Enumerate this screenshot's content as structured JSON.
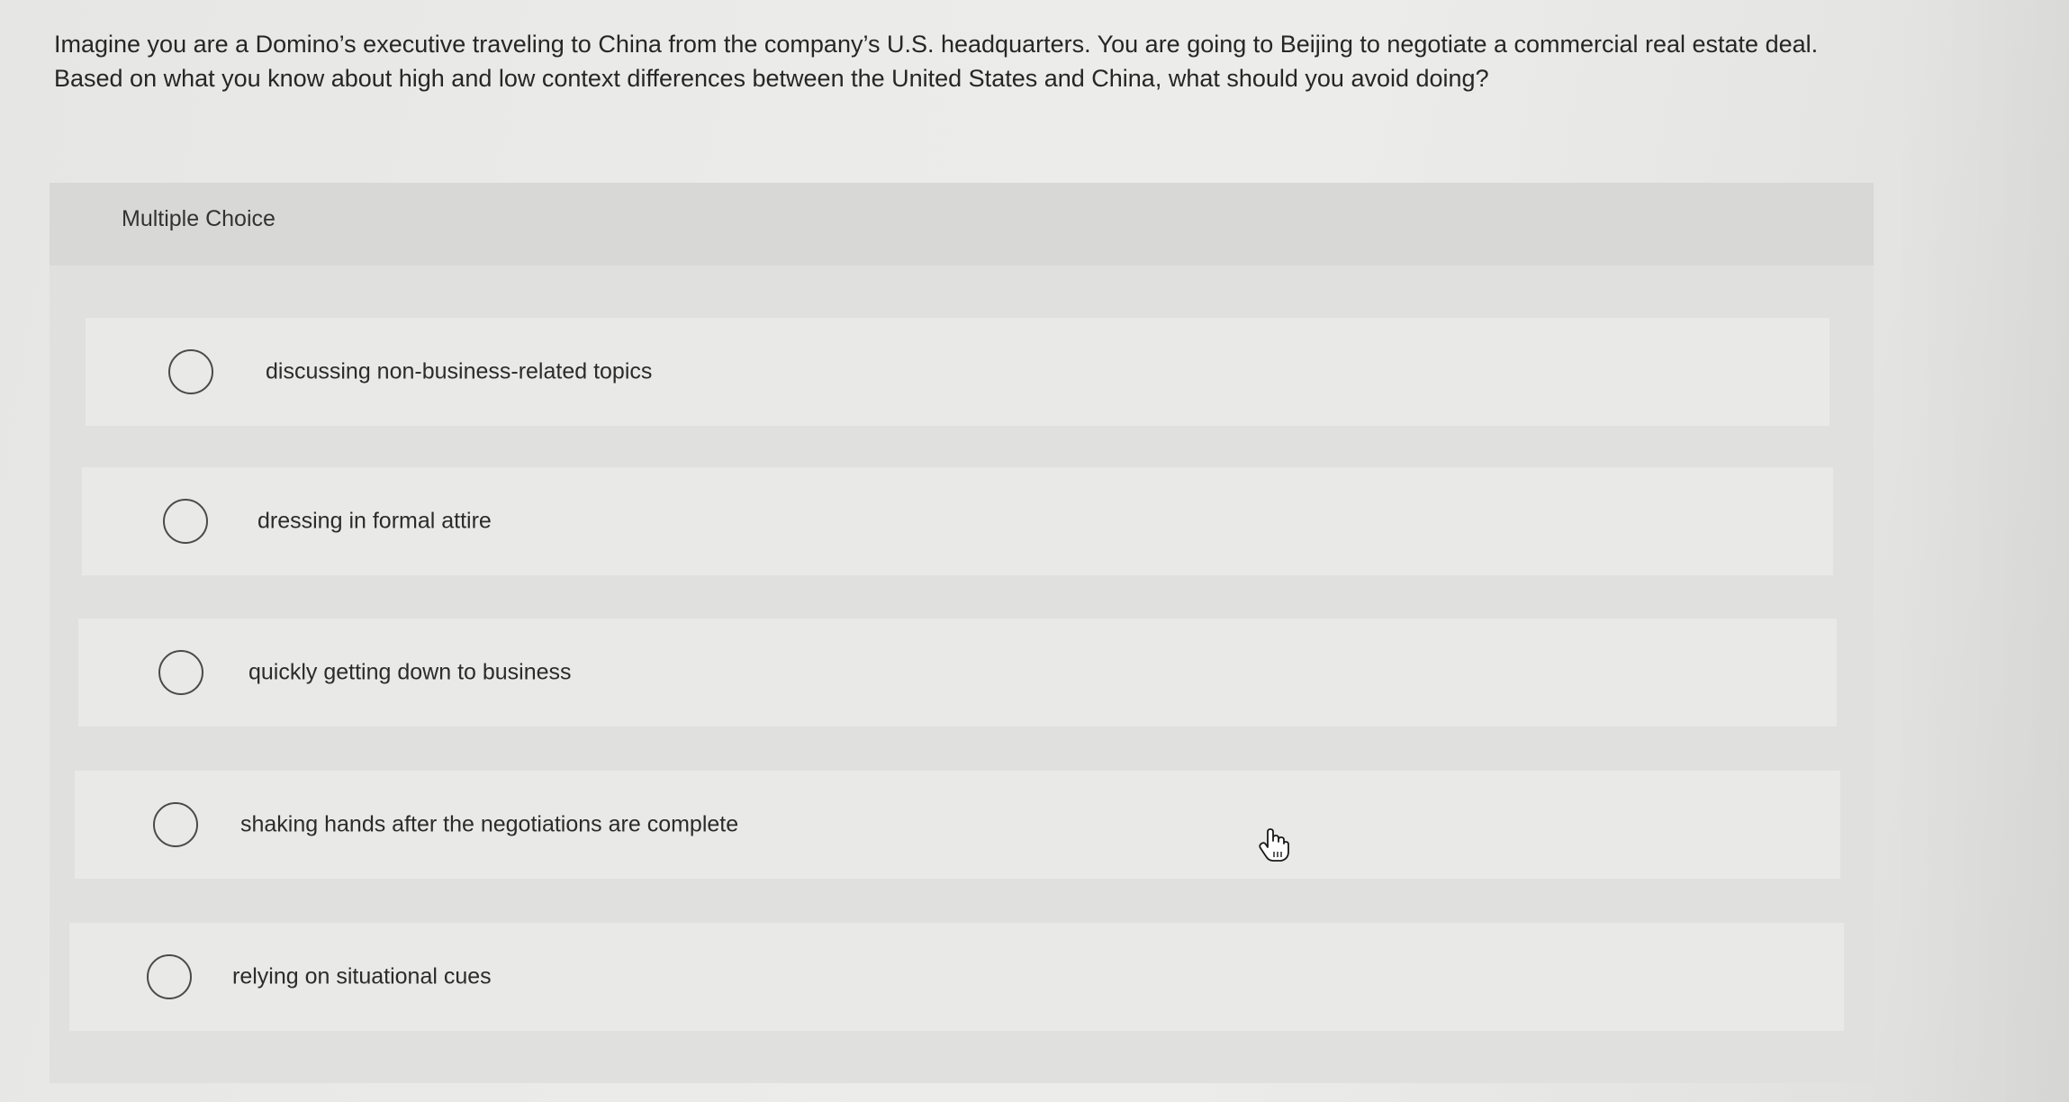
{
  "question": {
    "text": "Imagine you are a Domino’s executive traveling to China from the company’s U.S. headquarters. You are going to Beijing to negotiate a commercial real estate deal. Based on what you know about high and low context differences between the United States and China, what should you avoid doing?"
  },
  "multiple_choice": {
    "title": "Multiple Choice",
    "options": [
      {
        "label": "discussing non-business-related topics",
        "selected": false
      },
      {
        "label": "dressing in formal attire",
        "selected": false
      },
      {
        "label": "quickly getting down to business",
        "selected": false
      },
      {
        "label": "shaking hands after the negotiations are complete",
        "selected": false
      },
      {
        "label": "relying on situational cues",
        "selected": false
      }
    ]
  },
  "cursor": {
    "icon": "hand-pointer-icon"
  }
}
